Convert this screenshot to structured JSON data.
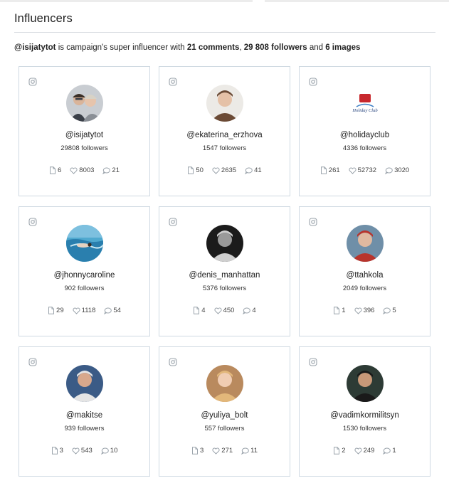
{
  "page": {
    "title": "Influencers",
    "summary": {
      "handle": "@isijatytot",
      "text1": " is campaign's super influencer with ",
      "comments": "21 comments",
      "sep": ", ",
      "followers": "29 808 followers",
      "text2": " and ",
      "images": "6 images"
    }
  },
  "colors": {
    "card_border": "#cfd9e2",
    "icon_gray": "#9aa3ab",
    "text": "#1e1e1e"
  },
  "icons": {
    "platform": "instagram-icon",
    "images": "document-icon",
    "likes": "heart-icon",
    "comments": "comment-bubble-icon"
  },
  "influencers": [
    {
      "handle": "@isijatytot",
      "followers": "29808 followers",
      "images": "6",
      "likes": "8003",
      "comments": "21",
      "avatar": "couple-photo",
      "bg": "#c9cdd2",
      "fg": "#3a3f48",
      "skin": "#d9b49a"
    },
    {
      "handle": "@ekaterina_erzhova",
      "followers": "1547 followers",
      "images": "50",
      "likes": "2635",
      "comments": "41",
      "avatar": "curly-hair-photo",
      "bg": "#eceae6",
      "fg": "#6b4a35",
      "skin": "#e5c1a7"
    },
    {
      "handle": "@holidayclub",
      "followers": "4336 followers",
      "images": "261",
      "likes": "52732",
      "comments": "3020",
      "avatar": "holiday-club-logo",
      "logo_text": "Holiday Club",
      "bg": "#ffffff",
      "fg": "#c8282e",
      "skin": "#c8282e"
    },
    {
      "handle": "@jhonnycaroline",
      "followers": "902 followers",
      "images": "29",
      "likes": "1118",
      "comments": "54",
      "avatar": "swimmer-photo",
      "bg": "#4fa9cf",
      "fg": "#2a7fae",
      "skin": "#cbe9f3"
    },
    {
      "handle": "@denis_manhattan",
      "followers": "5376 followers",
      "images": "4",
      "likes": "450",
      "comments": "4",
      "avatar": "bw-portrait-photo",
      "bg": "#1b1b1b",
      "fg": "#cfcfcf",
      "skin": "#9a9a9a"
    },
    {
      "handle": "@ttahkola",
      "followers": "2049 followers",
      "images": "1",
      "likes": "396",
      "comments": "5",
      "avatar": "man-red-jacket-photo",
      "bg": "#6f8fa8",
      "fg": "#b8342c",
      "skin": "#e0b9a0"
    },
    {
      "handle": "@makitse",
      "followers": "939 followers",
      "images": "3",
      "likes": "543",
      "comments": "10",
      "avatar": "man-gray-hair-photo",
      "bg": "#3b5b86",
      "fg": "#e4e4e4",
      "skin": "#d8a88c"
    },
    {
      "handle": "@yuliya_bolt",
      "followers": "557 followers",
      "images": "3",
      "likes": "271",
      "comments": "11",
      "avatar": "blonde-woman-photo",
      "bg": "#b98a5e",
      "fg": "#e2b77a",
      "skin": "#f0cdb3"
    },
    {
      "handle": "@vadimkormilitsyn",
      "followers": "1530 followers",
      "images": "2",
      "likes": "249",
      "comments": "1",
      "avatar": "man-suit-photo",
      "bg": "#2d3b35",
      "fg": "#1a1a1a",
      "skin": "#c89878"
    }
  ]
}
